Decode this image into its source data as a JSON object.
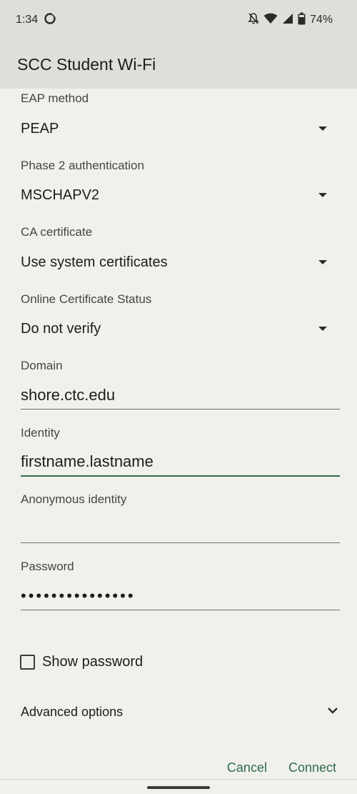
{
  "status_bar": {
    "time": "1:34",
    "battery_text": "74%"
  },
  "dialog": {
    "title": "SCC Student Wi-Fi"
  },
  "eap_method": {
    "label": "EAP method",
    "value": "PEAP"
  },
  "phase2": {
    "label": "Phase 2 authentication",
    "value": "MSCHAPV2"
  },
  "ca_certificate": {
    "label": "CA certificate",
    "value": "Use system certificates"
  },
  "online_cert_status": {
    "label": "Online Certificate Status",
    "value": "Do not verify"
  },
  "domain": {
    "label": "Domain",
    "value": "shore.ctc.edu"
  },
  "identity": {
    "label": "Identity",
    "value": "firstname.lastname"
  },
  "anonymous_identity": {
    "label": "Anonymous identity",
    "value": ""
  },
  "password": {
    "label": "Password",
    "masked_value": "•••••••••••••••"
  },
  "show_password": {
    "label": "Show password",
    "checked": false
  },
  "advanced_options": {
    "label": "Advanced options"
  },
  "actions": {
    "cancel_label": "Cancel",
    "connect_label": "Connect"
  },
  "colors": {
    "accent": "#2f6b4b",
    "header_bg": "#dedfda",
    "page_bg": "#f1f1ec"
  }
}
